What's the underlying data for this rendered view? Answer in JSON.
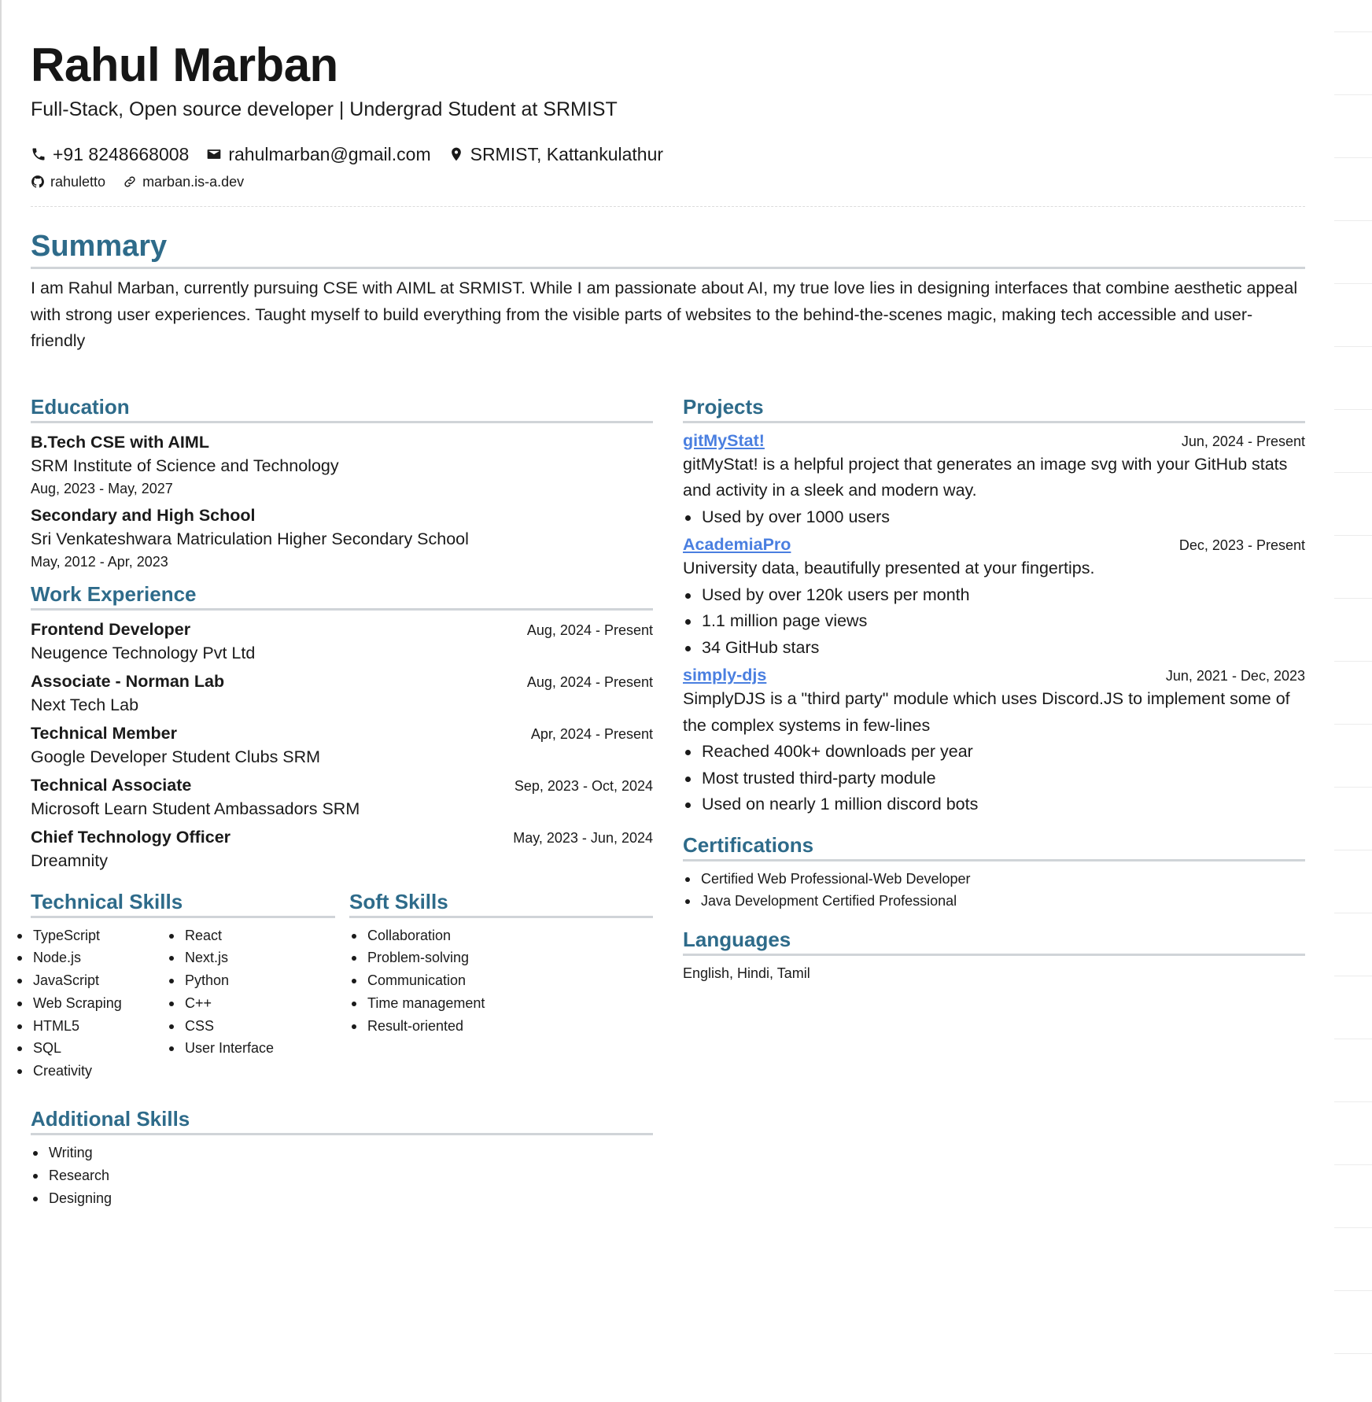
{
  "name": "Rahul Marban",
  "headline": "Full-Stack, Open source developer | Undergrad Student at SRMIST",
  "contact": {
    "phone": "+91 8248668008",
    "email": "rahulmarban@gmail.com",
    "location": "SRMIST, Kattankulathur",
    "github": "rahuletto",
    "website": "marban.is-a.dev"
  },
  "icons": {
    "phone": "phone-icon",
    "email": "envelope-icon",
    "location": "map-pin-icon",
    "github": "github-icon",
    "website": "link-icon"
  },
  "colors": {
    "heading": "#2e6b8a",
    "link": "#4a7fe0",
    "rule": "#d0d4d8"
  },
  "summary": {
    "title": "Summary",
    "text": "I am Rahul Marban, currently pursuing CSE with AIML at SRMIST. While I am passionate about AI, my true love lies in designing interfaces that combine aesthetic appeal with strong user experiences. Taught myself to build everything from the visible parts of websites to the behind-the-scenes magic, making tech accessible and user-friendly"
  },
  "education": {
    "title": "Education",
    "items": [
      {
        "degree": "B.Tech CSE with AIML",
        "school": "SRM Institute of Science and Technology",
        "dates": "Aug, 2023 - May, 2027"
      },
      {
        "degree": "Secondary and High School",
        "school": "Sri Venkateshwara Matriculation Higher Secondary School",
        "dates": "May, 2012 - Apr, 2023"
      }
    ]
  },
  "work": {
    "title": "Work Experience",
    "items": [
      {
        "role": "Frontend Developer",
        "org": "Neugence Technology Pvt Ltd",
        "dates": "Aug, 2024 - Present"
      },
      {
        "role": "Associate - Norman Lab",
        "org": "Next Tech Lab",
        "dates": "Aug, 2024 - Present"
      },
      {
        "role": "Technical Member",
        "org": "Google Developer Student Clubs SRM",
        "dates": "Apr, 2024 - Present"
      },
      {
        "role": "Technical Associate",
        "org": "Microsoft Learn Student Ambassadors SRM",
        "dates": "Sep, 2023 - Oct, 2024"
      },
      {
        "role": "Chief Technology Officer",
        "org": "Dreamnity",
        "dates": "May, 2023 - Jun, 2024"
      }
    ]
  },
  "technical_skills": {
    "title": "Technical Skills",
    "col1": [
      "TypeScript",
      "Node.js",
      "JavaScript",
      "Web Scraping",
      "HTML5",
      "SQL",
      "Creativity"
    ],
    "col2": [
      "React",
      "Next.js",
      "Python",
      "C++",
      "CSS",
      "User Interface"
    ]
  },
  "soft_skills": {
    "title": "Soft Skills",
    "items": [
      "Collaboration",
      "Problem-solving",
      "Communication",
      "Time management",
      "Result-oriented"
    ]
  },
  "additional_skills": {
    "title": "Additional Skills",
    "items": [
      "Writing",
      "Research",
      "Designing"
    ]
  },
  "projects": {
    "title": "Projects",
    "items": [
      {
        "name": "gitMyStat!",
        "dates": "Jun, 2024 - Present",
        "description": "gitMyStat! is a helpful project that generates an image svg with your GitHub stats and activity in a sleek and modern way.",
        "bullets": [
          "Used by over 1000 users"
        ]
      },
      {
        "name": "AcademiaPro",
        "dates": "Dec, 2023 - Present",
        "description": "University data, beautifully presented at your fingertips.",
        "bullets": [
          "Used by over 120k users per month",
          "1.1 million page views",
          "34 GitHub stars"
        ]
      },
      {
        "name": "simply-djs",
        "dates": "Jun, 2021 - Dec, 2023",
        "description": "SimplyDJS is a \"third party\" module which uses Discord.JS to implement some of the complex systems in few-lines",
        "bullets": [
          "Reached 400k+ downloads per year",
          "Most trusted third-party module",
          "Used on nearly 1 million discord bots"
        ]
      }
    ]
  },
  "certifications": {
    "title": "Certifications",
    "items": [
      "Certified Web Professional-Web Developer",
      "Java Development Certified Professional"
    ]
  },
  "languages": {
    "title": "Languages",
    "text": "English, Hindi, Tamil"
  }
}
